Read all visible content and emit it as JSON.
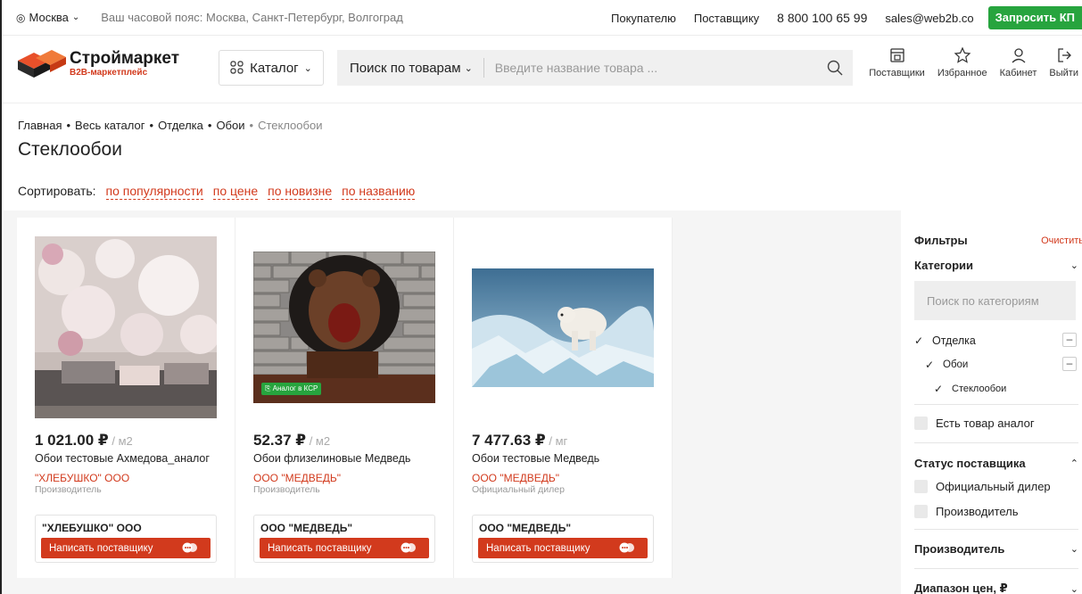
{
  "topbar": {
    "city": "Москва",
    "timezone": "Ваш часовой пояс: Москва, Санкт-Петербург, Волгоград",
    "links": [
      "Покупателю",
      "Поставщику"
    ],
    "phone": "8 800 100 65 99",
    "email": "sales@web2b.co",
    "request_button": "Запросить КП"
  },
  "header": {
    "logo_title": "Строймаркет",
    "logo_subtitle": "B2B-маркетплейс",
    "catalog_label": "Каталог",
    "search_scope": "Поиск по товарам",
    "search_placeholder": "Введите название товара ...",
    "icons": [
      {
        "label": "Поставщики",
        "icon": "store-icon"
      },
      {
        "label": "Избранное",
        "icon": "star-icon"
      },
      {
        "label": "Кабинет",
        "icon": "user-icon"
      },
      {
        "label": "Выйти",
        "icon": "logout-icon"
      }
    ]
  },
  "breadcrumbs": [
    "Главная",
    "Весь каталог",
    "Отделка",
    "Обои",
    "Стеклообои"
  ],
  "page_title": "Стеклообои",
  "sort": {
    "label": "Сортировать:",
    "options": [
      "по популярности",
      "по цене",
      "по новизне",
      "по названию"
    ]
  },
  "products": [
    {
      "price": "1 021.00 ₽",
      "unit": " / м2",
      "title": "Обои тестовые Ахмедова_аналог",
      "seller": "\"ХЛЕБУШКО\" ООО",
      "seller_type": "Производитель",
      "box_name": "\"ХЛЕБУШКО\" ООО",
      "button": "Написать поставщику",
      "image": "peony-flowers-wallpaper"
    },
    {
      "price": "52.37 ₽",
      "unit": " / м2",
      "title": "Обои флизелиновые Медведь",
      "seller": "ООО \"МЕДВЕДЬ\"",
      "seller_type": "Производитель",
      "box_name": "ООО \"МЕДВЕДЬ\"",
      "button": "Написать поставщику",
      "badge": "Аналог в КСР",
      "image": "bear-brick-wall"
    },
    {
      "price": "7 477.63 ₽",
      "unit": " / мг",
      "title": "Обои тестовые Медведь",
      "seller": "ООО \"МЕДВЕДЬ\"",
      "seller_type": "Официальный дилер",
      "box_name": "ООО \"МЕДВЕДЬ\"",
      "button": "Написать поставщику",
      "image": "polar-bear-ice"
    }
  ],
  "filters": {
    "title": "Фильтры",
    "clear": "Очистить",
    "categories_title": "Категории",
    "categories_placeholder": "Поиск по категориям",
    "tree": [
      "Отделка",
      "Обои",
      "Стеклообои"
    ],
    "analog_label": "Есть товар аналог",
    "supplier_status_title": "Статус поставщика",
    "supplier_status_options": [
      "Официальный дилер",
      "Производитель"
    ],
    "manufacturer_title": "Производитель",
    "price_range_title": "Диапазон цен, ₽"
  },
  "colors": {
    "accent_red": "#d23a1d",
    "accent_green": "#27a43e"
  }
}
